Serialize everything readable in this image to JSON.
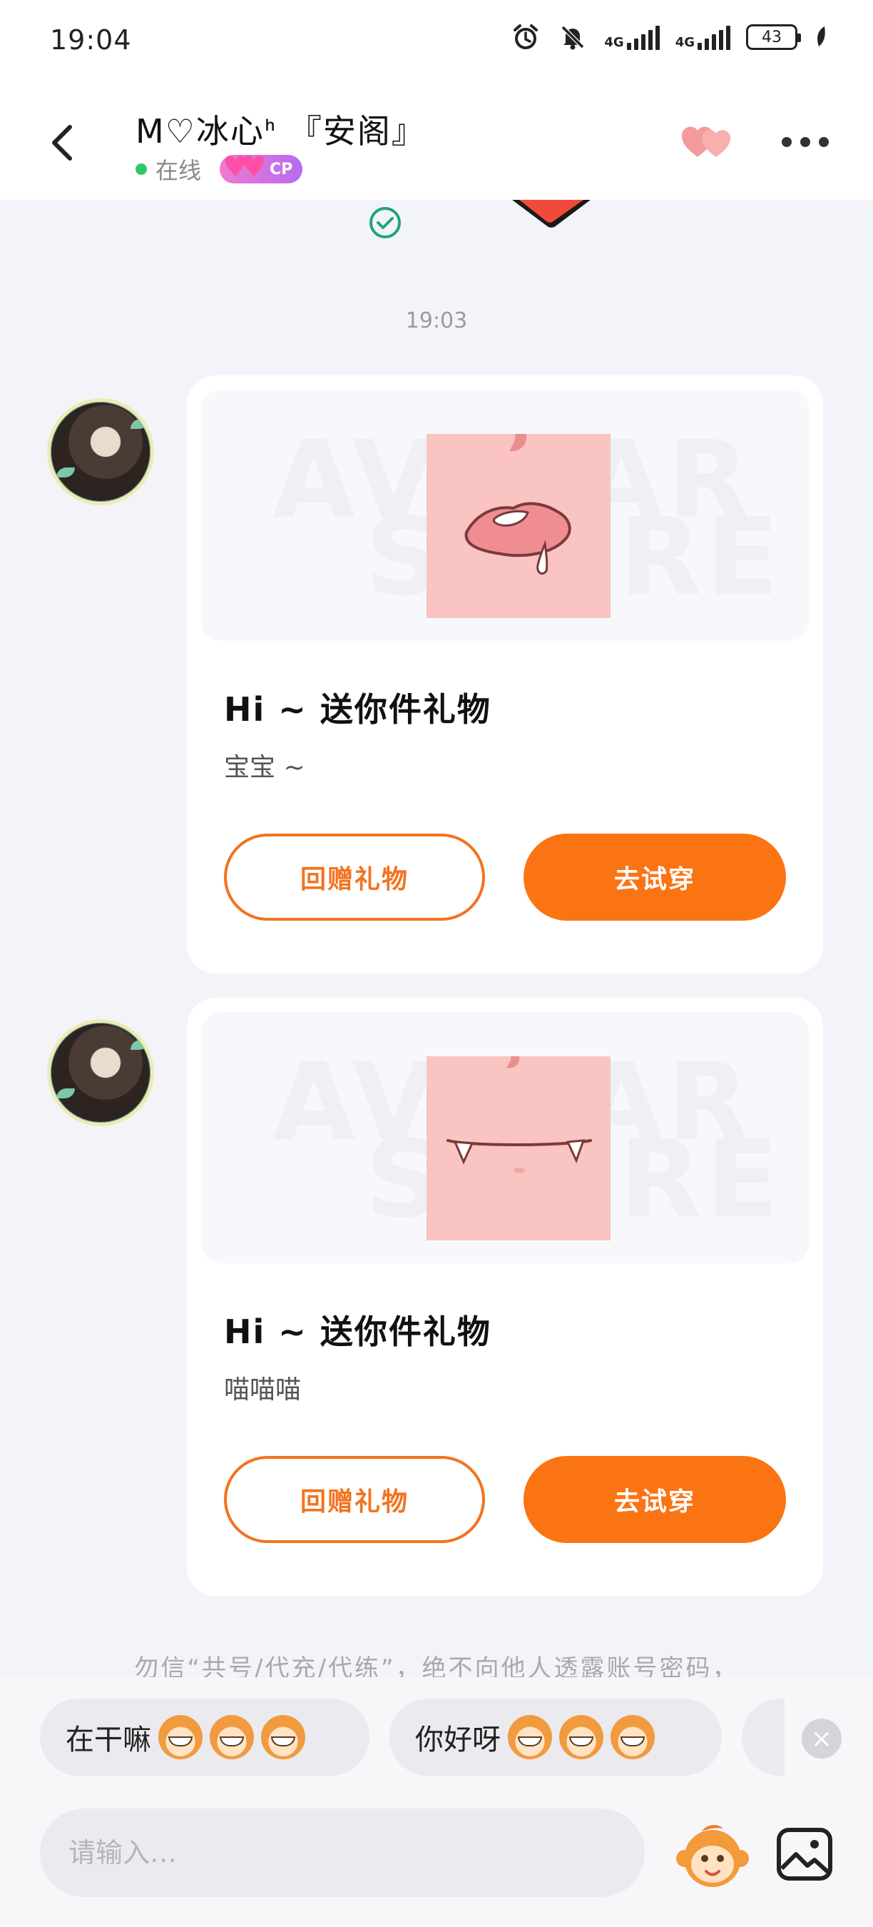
{
  "status_bar": {
    "time": "19:04",
    "network_1": "4G",
    "network_2": "4G",
    "battery": "43",
    "icons": [
      "alarm-icon",
      "mute-icon",
      "signal-icon",
      "signal-icon",
      "battery-icon",
      "leaf-icon"
    ]
  },
  "header": {
    "name": "M♡冰心ᑋ 『安阁』",
    "online_text": "在线",
    "badge": "CP",
    "icons": [
      "back-icon",
      "hearts-icon",
      "more-icon"
    ]
  },
  "chat": {
    "timestamp": "19:03",
    "messages": [
      {
        "watermark_top": "AVATAR",
        "watermark_bottom": "STORE",
        "title": "Hi ~ 送你件礼物",
        "subtitle": "宝宝 ~",
        "left_button": "回赠礼物",
        "right_button": "去试穿"
      },
      {
        "watermark_top": "AVATAR",
        "watermark_bottom": "STORE",
        "title": "Hi ~ 送你件礼物",
        "subtitle": "喵喵喵",
        "left_button": "回赠礼物",
        "right_button": "去试穿"
      }
    ],
    "notice": "勿信“共号/代充/代练”，绝不向他人透露账号密码，"
  },
  "bottom": {
    "quick_replies": [
      {
        "text": "在干嘛",
        "emoji": "grinning-monkey-emoji"
      },
      {
        "text": "你好呀",
        "emoji": "surprised-monkey-emoji"
      }
    ],
    "input_placeholder": "请输入…",
    "input_value": "",
    "icons": [
      "close-icon",
      "monkey-emoji-icon",
      "image-icon"
    ]
  },
  "colors": {
    "accent": "#fb7414",
    "online": "#2fc86b",
    "check": "#20a579",
    "background": "#f3f4f9"
  }
}
